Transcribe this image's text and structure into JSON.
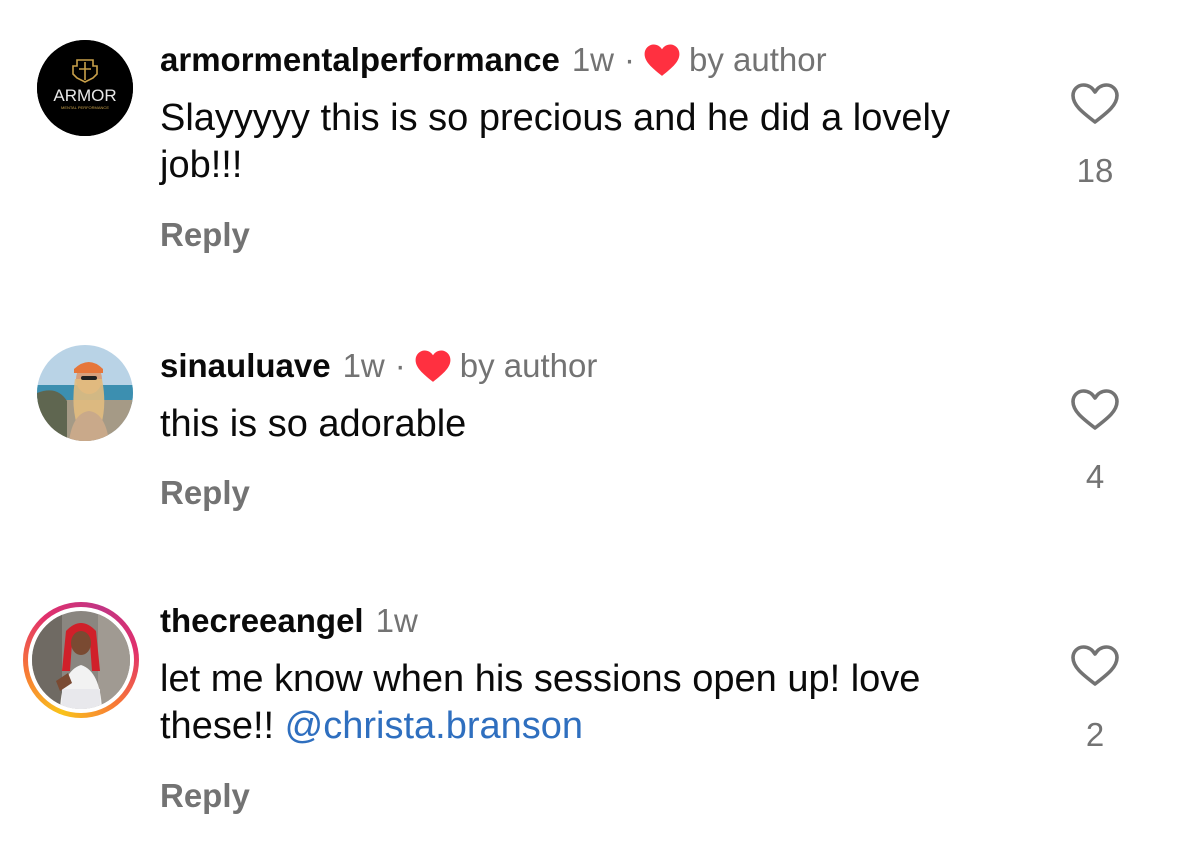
{
  "comments": [
    {
      "username": "armormentalperformance",
      "time": "1w",
      "dot": "·",
      "by_author": "by author",
      "text": "Slayyyyy this is so precious and he did a lovely job!!!",
      "reply_label": "Reply",
      "likes": "18",
      "avatar_text": "ARMOR",
      "avatar_subtext": "MENTAL PERFORMANCE"
    },
    {
      "username": "sinauluave",
      "time": "1w",
      "dot": "·",
      "by_author": "by author",
      "text": "this is so adorable",
      "reply_label": "Reply",
      "likes": "4"
    },
    {
      "username": "thecreeangel",
      "time": "1w",
      "text_before_mention": "let me know when his sessions open up! love these!! ",
      "mention": "@christa.branson",
      "reply_label": "Reply",
      "likes": "2"
    }
  ],
  "colors": {
    "heart_red": "#ff3040",
    "secondary_text": "#737373",
    "mention_blue": "#2f6fbf",
    "avatar_gold": "#c8a04a"
  }
}
